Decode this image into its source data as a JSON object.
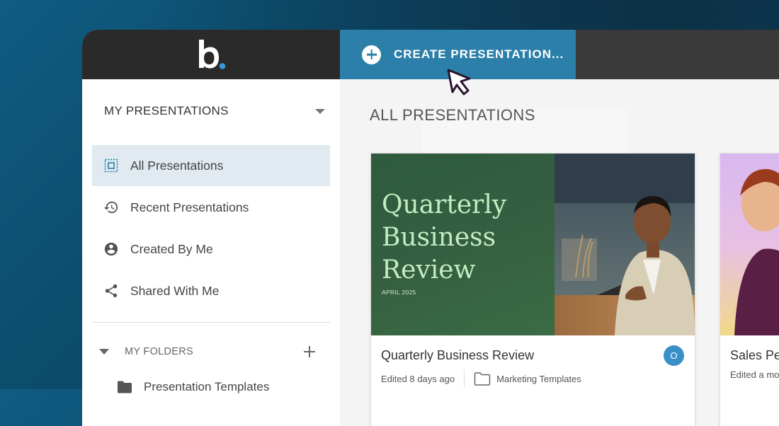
{
  "app": {
    "create_button_label": "CREATE PRESENTATION..."
  },
  "sidebar": {
    "header": "MY PRESENTATIONS",
    "items": [
      {
        "label": "All Presentations",
        "icon": "all-presentations-icon",
        "active": true
      },
      {
        "label": "Recent Presentations",
        "icon": "history-icon",
        "active": false
      },
      {
        "label": "Created By Me",
        "icon": "user-circle-icon",
        "active": false
      },
      {
        "label": "Shared With Me",
        "icon": "share-icon",
        "active": false
      }
    ],
    "folders_header": "MY FOLDERS",
    "folders": [
      {
        "label": "Presentation Templates"
      }
    ]
  },
  "main": {
    "title": "ALL PRESENTATIONS",
    "cards": [
      {
        "title": "Quarterly Business Review",
        "slide_title": "Quarterly Business Review",
        "slide_date": "APRIL 2025",
        "edited": "Edited 8 days ago",
        "folder": "Marketing Templates",
        "owner_initial": "O"
      },
      {
        "title": "Sales Pe",
        "edited": "Edited a mo"
      }
    ]
  },
  "colors": {
    "accent": "#2b7fa8",
    "topbar": "#3a3a3a",
    "logo_dot": "#3a9ad9",
    "active_nav": "#e1eaf0",
    "avatar": "#3a8fc7"
  }
}
